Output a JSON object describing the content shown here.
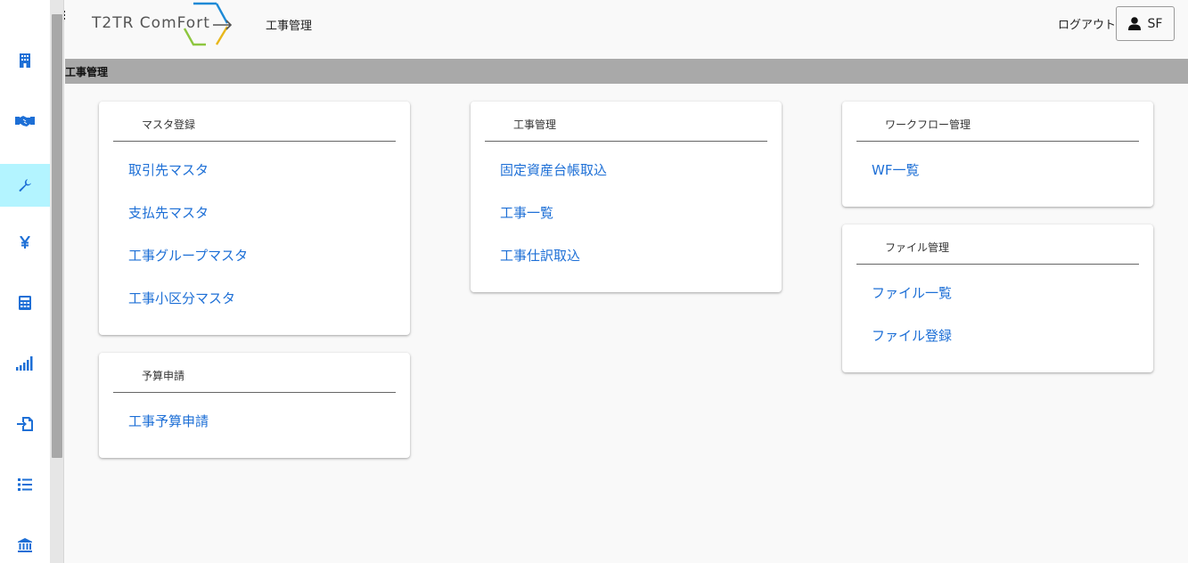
{
  "header": {
    "logo_text": "T2TR ComFort",
    "title": "工事管理",
    "logout_label": "ログアウト",
    "user_initials": "SF"
  },
  "breadcrumb": {
    "label": "工事管理"
  },
  "sidebar": {
    "items": [
      {
        "icon": "building-icon"
      },
      {
        "icon": "handshake-icon"
      },
      {
        "icon": "wrench-icon",
        "active": true
      },
      {
        "icon": "yen-icon"
      },
      {
        "icon": "calculator-icon"
      },
      {
        "icon": "signal-bars-icon"
      },
      {
        "icon": "file-import-icon"
      },
      {
        "icon": "list-icon"
      },
      {
        "icon": "bank-icon"
      }
    ]
  },
  "cards": {
    "master": {
      "title": "マスタ登録",
      "links": [
        "取引先マスタ",
        "支払先マスタ",
        "工事グループマスタ",
        "工事小区分マスタ"
      ]
    },
    "budget": {
      "title": "予算申請",
      "links": [
        "工事予算申請"
      ]
    },
    "construction": {
      "title": "工事管理",
      "links": [
        "固定資産台帳取込",
        "工事一覧",
        "工事仕訳取込"
      ]
    },
    "workflow": {
      "title": "ワークフロー管理",
      "links": [
        "WF一覧"
      ]
    },
    "file": {
      "title": "ファイル管理",
      "links": [
        "ファイル一覧",
        "ファイル登録"
      ]
    }
  },
  "colors": {
    "link": "#1d6fd6",
    "sidebar_icon": "#1d6fd6",
    "sidebar_active_bg": "#b3f4ff",
    "breadcrumb_bg": "#a9a9a9"
  }
}
